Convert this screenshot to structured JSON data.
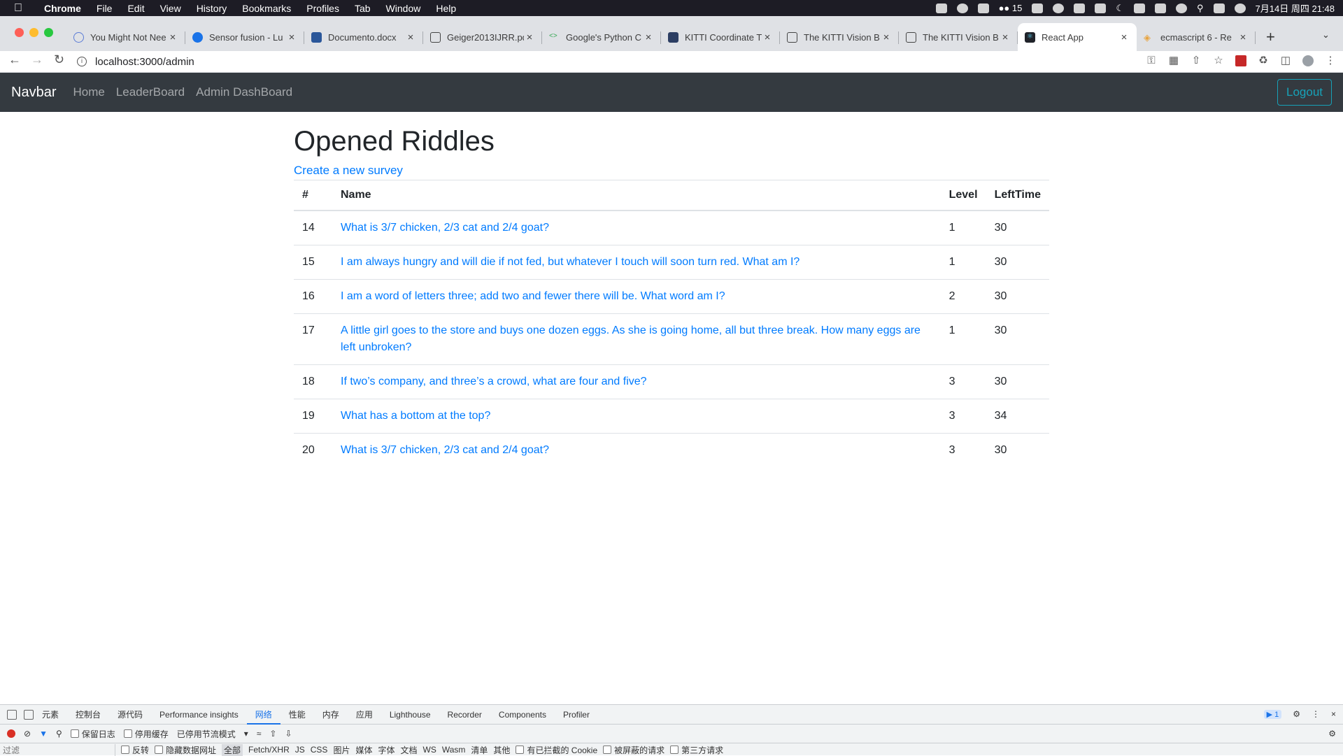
{
  "menubar": {
    "items": [
      "Chrome",
      "File",
      "Edit",
      "View",
      "History",
      "Bookmarks",
      "Profiles",
      "Tab",
      "Window",
      "Help"
    ],
    "wechat_count": "15",
    "datetime": "7月14日 周四  21:48"
  },
  "tabs": [
    {
      "title": "You Might Not Nee",
      "favicon": "gear-icon"
    },
    {
      "title": "Sensor fusion - Lu",
      "favicon": "cloud-icon"
    },
    {
      "title": "Documento.docx",
      "favicon": "word-icon"
    },
    {
      "title": "Geiger2013IJRR.pd",
      "favicon": "page-icon"
    },
    {
      "title": "Google's Python C",
      "favicon": "code-icon"
    },
    {
      "title": "KITTI Coordinate T",
      "favicon": "tds-icon"
    },
    {
      "title": "The KITTI Vision B",
      "favicon": "page-icon"
    },
    {
      "title": "The KITTI Vision B",
      "favicon": "page-icon"
    },
    {
      "title": "React App",
      "favicon": "react-icon",
      "active": true
    },
    {
      "title": "ecmascript 6 - Re",
      "favicon": "js-icon"
    }
  ],
  "address_bar": {
    "url": "localhost:3000/admin"
  },
  "navbar": {
    "brand": "Navbar",
    "links": [
      "Home",
      "LeaderBoard",
      "Admin DashBoard"
    ],
    "logout_label": "Logout"
  },
  "page": {
    "title": "Opened Riddles",
    "create_link": "Create a new survey",
    "columns": [
      "#",
      "Name",
      "Level",
      "LeftTime"
    ],
    "rows": [
      {
        "id": "14",
        "name": "What is 3/7 chicken, 2/3 cat and 2/4 goat?",
        "level": "1",
        "lefttime": "30"
      },
      {
        "id": "15",
        "name": "I am always hungry and will die if not fed, but whatever I touch will soon turn red. What am I?",
        "level": "1",
        "lefttime": "30"
      },
      {
        "id": "16",
        "name": "I am a word of letters three; add two and fewer there will be. What word am I?",
        "level": "2",
        "lefttime": "30"
      },
      {
        "id": "17",
        "name": "A little girl goes to the store and buys one dozen eggs. As she is going home, all but three break. How many eggs are left unbroken?",
        "level": "1",
        "lefttime": "30"
      },
      {
        "id": "18",
        "name": "If two’s company, and three’s a crowd, what are four and five?",
        "level": "3",
        "lefttime": "30"
      },
      {
        "id": "19",
        "name": "What has a bottom at the top?",
        "level": "3",
        "lefttime": "34"
      },
      {
        "id": "20",
        "name": "What is 3/7 chicken, 2/3 cat and 2/4 goat?",
        "level": "3",
        "lefttime": "30"
      }
    ]
  },
  "devtools": {
    "tabs": [
      "元素",
      "控制台",
      "源代码",
      "Performance insights",
      "网络",
      "性能",
      "内存",
      "应用",
      "Lighthouse",
      "Recorder",
      "Components",
      "Profiler"
    ],
    "active_tab": "网络",
    "issues_count": "1",
    "preserve_log": "保留日志",
    "disable_cache": "停用缓存",
    "throttle": "已停用节流模式",
    "filter_placeholder": "过滤",
    "invert": "反转",
    "hide_data_urls": "隐藏数据网址",
    "filter_types": [
      "全部",
      "Fetch/XHR",
      "JS",
      "CSS",
      "图片",
      "媒体",
      "字体",
      "文档",
      "WS",
      "Wasm",
      "清单",
      "其他"
    ],
    "blocked_cookies": "有已拦截的 Cookie",
    "blocked_requests": "被屏蔽的请求",
    "third_party": "第三方请求"
  },
  "colors": {
    "link": "#007bff",
    "navbar_bg": "#343a40",
    "logout": "#17a2b8"
  }
}
